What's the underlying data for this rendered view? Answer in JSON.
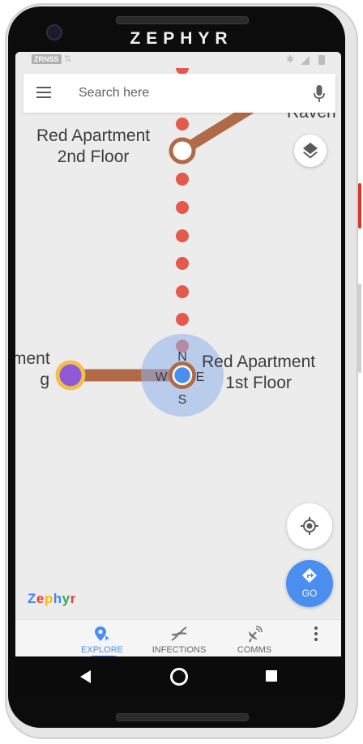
{
  "device": {
    "brand": "ZEPHYR"
  },
  "status_bar": {
    "carrier": "ZRNSS",
    "data_icon": "⇅",
    "bluetooth_icon": "bluetooth-icon",
    "signal_icon": "signal-icon",
    "battery_icon": "battery-icon"
  },
  "search": {
    "placeholder": "Search here",
    "menu_icon": "hamburger-menu-icon",
    "mic_icon": "microphone-icon"
  },
  "map": {
    "labels": {
      "red_2nd": "Red Apartment\n2nd Floor",
      "red_1st": "Red Apartment\n1st Floor",
      "left_partial": "ment\ng",
      "top_right_partial": "Raven"
    },
    "compass": {
      "n": "N",
      "e": "E",
      "s": "S",
      "w": "W"
    },
    "colors": {
      "route_path": "#b06a48",
      "dotted_path": "#e35a4d",
      "user_dot": "#4a8eef",
      "accuracy_halo": "#8fb2ec",
      "purple_node": "#8e5ad8",
      "purple_ring": "#f3be4a"
    }
  },
  "buttons": {
    "layers_icon": "layers-icon",
    "locate_icon": "my-location-icon",
    "go_icon": "directions-icon",
    "go_label": "GO"
  },
  "logo": {
    "letters": [
      "Z",
      "e",
      "p",
      "h",
      "y",
      "r"
    ],
    "colors": [
      "#4285f4",
      "#ea4335",
      "#fbbc05",
      "#4285f4",
      "#34a853",
      "#ea4335"
    ]
  },
  "bottom_nav": {
    "items": [
      {
        "label": "EXPLORE",
        "icon": "explore-pin-icon",
        "active": true
      },
      {
        "label": "INFECTIONS",
        "icon": "dna-icon",
        "active": false
      },
      {
        "label": "COMMS",
        "icon": "satellite-dish-icon",
        "active": false
      }
    ],
    "overflow_icon": "more-vert-icon"
  },
  "system_nav": {
    "back_icon": "back-triangle-icon",
    "home_icon": "home-circle-icon",
    "recents_icon": "recents-square-icon"
  }
}
